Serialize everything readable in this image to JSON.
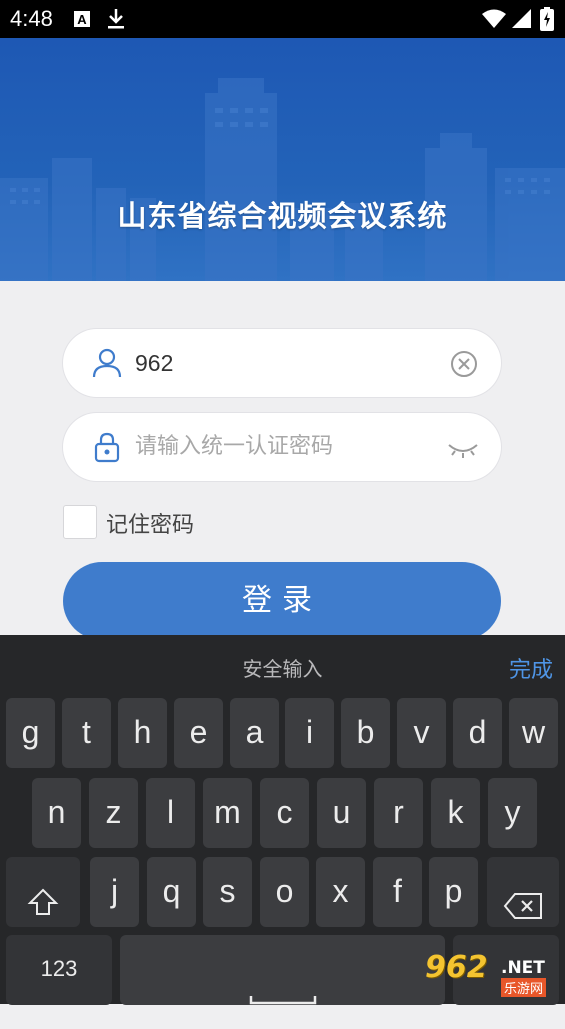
{
  "status_bar": {
    "time": "4:48",
    "icons": [
      "text-a-icon",
      "download-icon",
      "wifi-icon",
      "signal-icon",
      "battery-icon"
    ]
  },
  "banner": {
    "title": "山东省综合视频会议系统",
    "color": "#1e58b4"
  },
  "login_form": {
    "username": {
      "value": "962",
      "icon": "user-icon",
      "clear_icon": "clear-icon"
    },
    "password": {
      "placeholder": "请输入统一认证密码",
      "icon": "lock-icon",
      "toggle_icon": "eye-closed-icon"
    },
    "remember_label": "记住密码",
    "remember_checked": false,
    "login_button": "登录",
    "accent_color": "#3f7ccc"
  },
  "keyboard": {
    "title": "安全输入",
    "done_label": "完成",
    "row1": [
      "g",
      "t",
      "h",
      "e",
      "a",
      "i",
      "b",
      "v",
      "d",
      "w"
    ],
    "row2": [
      "n",
      "z",
      "l",
      "m",
      "c",
      "u",
      "r",
      "k",
      "y"
    ],
    "row3": [
      "j",
      "q",
      "s",
      "o",
      "x",
      "f",
      "p"
    ],
    "numbers_label": "123",
    "shift_icon": "shift-icon",
    "backspace_icon": "backspace-icon",
    "space_icon": "space-icon"
  },
  "watermark": {
    "logo": "962",
    "suffix": ".NET",
    "site": "乐游网"
  }
}
